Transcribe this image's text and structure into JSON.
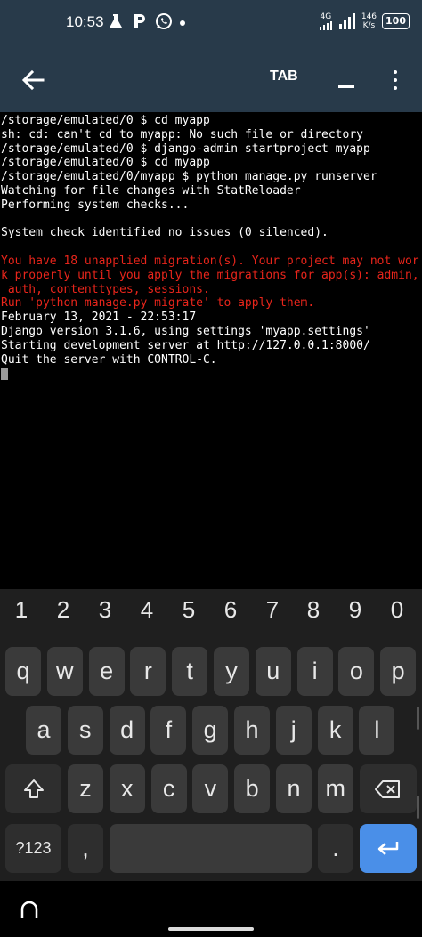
{
  "status_bar": {
    "time": "10:53",
    "network_type": "4G",
    "speed_value": "146",
    "speed_unit": "K/s",
    "battery": "100",
    "notification_icons": [
      "flask-icon",
      "p-app-icon",
      "whatsapp-icon",
      "dot-icon"
    ]
  },
  "app_bar": {
    "tab_label": "TAB",
    "underscore_label": "_"
  },
  "terminal": {
    "lines": [
      {
        "text": "/storage/emulated/0 $ cd myapp",
        "type": "normal"
      },
      {
        "text": "sh: cd: can't cd to myapp: No such file or directory",
        "type": "normal"
      },
      {
        "text": "/storage/emulated/0 $ django-admin startproject myapp",
        "type": "normal"
      },
      {
        "text": "/storage/emulated/0 $ cd myapp",
        "type": "normal"
      },
      {
        "text": "/storage/emulated/0/myapp $ python manage.py runserver",
        "type": "normal"
      },
      {
        "text": "Watching for file changes with StatReloader",
        "type": "normal"
      },
      {
        "text": "Performing system checks...",
        "type": "normal"
      },
      {
        "text": "",
        "type": "normal"
      },
      {
        "text": "System check identified no issues (0 silenced).",
        "type": "normal"
      },
      {
        "text": "",
        "type": "normal"
      },
      {
        "text": "You have 18 unapplied migration(s). Your project may not wor",
        "type": "error"
      },
      {
        "text": "k properly until you apply the migrations for app(s): admin,",
        "type": "error"
      },
      {
        "text": " auth, contenttypes, sessions.",
        "type": "error"
      },
      {
        "text": "Run 'python manage.py migrate' to apply them.",
        "type": "error"
      },
      {
        "text": "February 13, 2021 - 22:53:17",
        "type": "normal"
      },
      {
        "text": "Django version 3.1.6, using settings 'myapp.settings'",
        "type": "normal"
      },
      {
        "text": "Starting development server at http://127.0.0.1:8000/",
        "type": "normal"
      },
      {
        "text": "Quit the server with CONTROL-C.",
        "type": "normal"
      }
    ]
  },
  "keyboard": {
    "numbers": [
      "1",
      "2",
      "3",
      "4",
      "5",
      "6",
      "7",
      "8",
      "9",
      "0"
    ],
    "row1": [
      "q",
      "w",
      "e",
      "r",
      "t",
      "y",
      "u",
      "i",
      "o",
      "p"
    ],
    "row2": [
      "a",
      "s",
      "d",
      "f",
      "g",
      "h",
      "j",
      "k",
      "l"
    ],
    "row3": [
      "z",
      "x",
      "c",
      "v",
      "b",
      "n",
      "m"
    ],
    "symbols_label": "?123",
    "comma_label": ",",
    "period_label": "."
  },
  "colors": {
    "bar_bg": "#283A4A",
    "error_text": "#e8251b",
    "enter_key": "#4a8fe8"
  }
}
